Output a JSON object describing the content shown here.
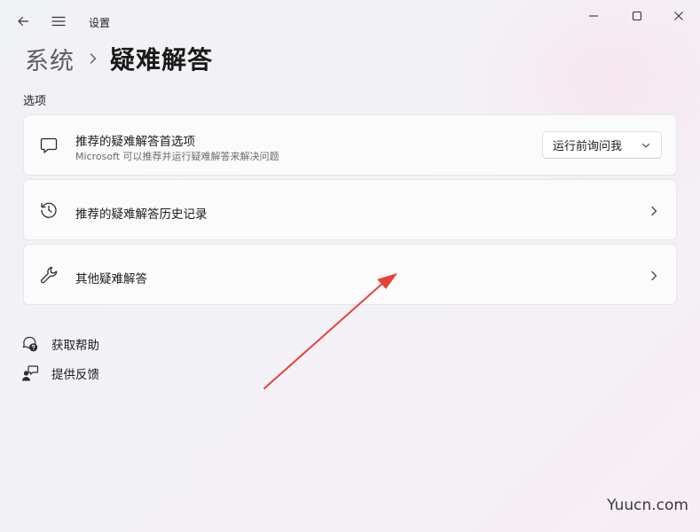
{
  "window": {
    "app_title": "设置",
    "controls": {
      "minimize": "minimize-icon",
      "maximize": "maximize-icon",
      "close": "close-icon"
    }
  },
  "breadcrumb": {
    "parent": "系统",
    "separator": "›",
    "current": "疑难解答"
  },
  "section": {
    "label": "选项"
  },
  "cards": [
    {
      "icon": "chat-icon",
      "title": "推荐的疑难解答首选项",
      "description": "Microsoft 可以推荐并运行疑难解答来解决问题",
      "dropdown_value": "运行前询问我"
    },
    {
      "icon": "history-icon",
      "title": "推荐的疑难解答历史记录"
    },
    {
      "icon": "wrench-icon",
      "title": "其他疑难解答"
    }
  ],
  "links": [
    {
      "icon": "help-icon",
      "label": "获取帮助"
    },
    {
      "icon": "feedback-icon",
      "label": "提供反馈"
    }
  ],
  "annotation": {
    "color": "#e8413a"
  },
  "watermark": "Yuucn.com"
}
